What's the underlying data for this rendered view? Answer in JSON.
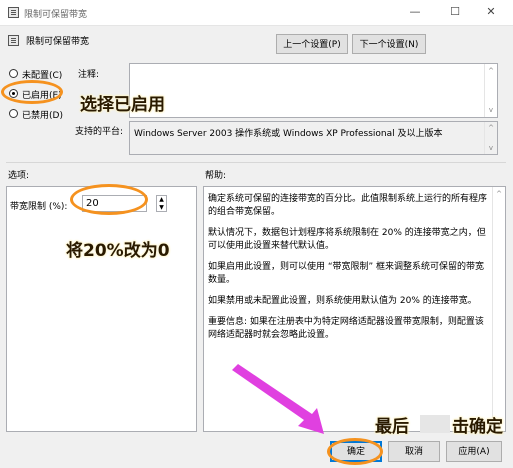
{
  "window": {
    "title": "限制可保留带宽",
    "controls": {
      "minimize": "—",
      "maximize": "☐",
      "close": "✕"
    }
  },
  "header": {
    "policy_name": "限制可保留带宽",
    "prev_button": "上一个设置(P)",
    "next_button": "下一个设置(N)"
  },
  "state": {
    "options": [
      {
        "label": "未配置(C)",
        "selected": false
      },
      {
        "label": "已启用(E)",
        "selected": true
      },
      {
        "label": "已禁用(D)",
        "selected": false
      }
    ]
  },
  "comment": {
    "label": "注释:",
    "value": ""
  },
  "supported": {
    "label": "支持的平台:",
    "value": "Windows Server 2003 操作系统或 Windows XP Professional 及以上版本"
  },
  "options_section": {
    "label": "选项:",
    "bandwidth_label": "带宽限制 (%):",
    "bandwidth_value": "20"
  },
  "help_section": {
    "label": "帮助:",
    "paragraphs": [
      "确定系统可保留的连接带宽的百分比。此值限制系统上运行的所有程序的组合带宽保留。",
      "默认情况下，数据包计划程序将系统限制在 20% 的连接带宽之内，但可以使用此设置来替代默认值。",
      "如果启用此设置，则可以使用 “带宽限制” 框来调整系统可保留的带宽数量。",
      "如果禁用或未配置此设置，则系统使用默认值为 20% 的连接带宽。",
      "重要信息: 如果在注册表中为特定网络适配器设置带宽限制，则配置该网络适配器时就会忽略此设置。"
    ]
  },
  "footer": {
    "ok_button": "确定",
    "cancel_button": "取消",
    "apply_button": "应用(A)"
  },
  "annotations": {
    "select_enabled": "选择已启用",
    "change_value": "将20%改为0",
    "finally_ok_prefix": "最后",
    "finally_ok_suffix": "击确定"
  },
  "colors": {
    "annotation_oval": "#f5921f",
    "arrow": "#e040e0",
    "default_button_border": "#0078d7"
  }
}
